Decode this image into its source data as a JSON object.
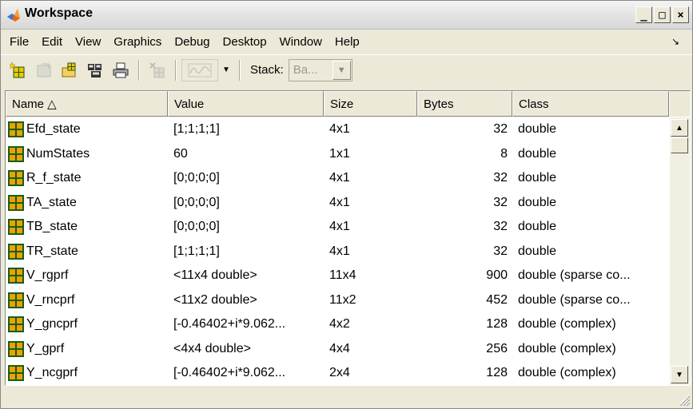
{
  "window": {
    "title": "Workspace",
    "icon": "matlab-logo-icon",
    "controls": {
      "minimize": "_",
      "maximize": "□",
      "close": "×"
    }
  },
  "menu": {
    "items": [
      "File",
      "Edit",
      "View",
      "Graphics",
      "Debug",
      "Desktop",
      "Window",
      "Help"
    ],
    "dock_glyph": "↘"
  },
  "toolbar": {
    "tools": [
      "new-variable-icon",
      "open-selection-icon",
      "import-data-icon",
      "save-icon",
      "print-icon",
      "delete-icon",
      "plot-icon",
      "dropdown-arrow-icon"
    ],
    "stack_label": "Stack:",
    "stack_value": "Ba...",
    "stack_arrow": "▼",
    "plot_arrow": "▼"
  },
  "table": {
    "columns": [
      "Name △",
      "Value",
      "Size",
      "Bytes",
      "Class"
    ],
    "rows": [
      {
        "name": "Efd_state",
        "value": "[1;1;1;1]",
        "size": "4x1",
        "bytes": "32",
        "class": "double"
      },
      {
        "name": "NumStates",
        "value": "60",
        "size": "1x1",
        "bytes": "8",
        "class": "double"
      },
      {
        "name": "R_f_state",
        "value": "[0;0;0;0]",
        "size": "4x1",
        "bytes": "32",
        "class": "double"
      },
      {
        "name": "TA_state",
        "value": "[0;0;0;0]",
        "size": "4x1",
        "bytes": "32",
        "class": "double"
      },
      {
        "name": "TB_state",
        "value": "[0;0;0;0]",
        "size": "4x1",
        "bytes": "32",
        "class": "double"
      },
      {
        "name": "TR_state",
        "value": "[1;1;1;1]",
        "size": "4x1",
        "bytes": "32",
        "class": "double"
      },
      {
        "name": "V_rgprf",
        "value": "<11x4 double>",
        "size": "11x4",
        "bytes": "900",
        "class": "double (sparse co..."
      },
      {
        "name": "V_rncprf",
        "value": "<11x2 double>",
        "size": "11x2",
        "bytes": "452",
        "class": "double (sparse co..."
      },
      {
        "name": "Y_gncprf",
        "value": "[-0.46402+i*9.062...",
        "size": "4x2",
        "bytes": "128",
        "class": "double (complex)"
      },
      {
        "name": "Y_gprf",
        "value": "<4x4 double>",
        "size": "4x4",
        "bytes": "256",
        "class": "double (complex)"
      },
      {
        "name": "Y_ncgprf",
        "value": "[-0.46402+i*9.062...",
        "size": "2x4",
        "bytes": "128",
        "class": "double (complex)"
      }
    ]
  },
  "scrollbar": {
    "up": "▲",
    "down": "▼"
  },
  "colors": {
    "window_bg": "#ece9d8",
    "variable_icon": "#e8a400",
    "variable_icon_grid": "#1a5c1a"
  }
}
